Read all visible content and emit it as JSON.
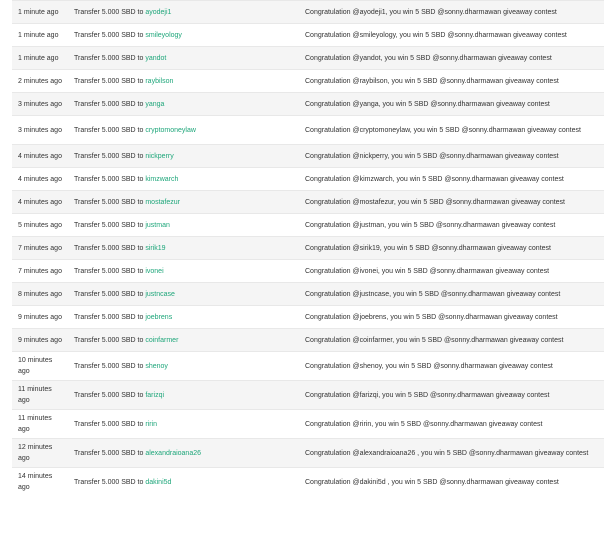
{
  "colors": {
    "link": "#1ea67a",
    "row_alt": "#f5f5f5",
    "border": "#e8e8e8",
    "text": "#333333"
  },
  "transactions": [
    {
      "time": "1 minute ago",
      "prefix": "Transfer 5.000 SBD to",
      "account": "ayodeji1",
      "memo": "Congratulation @ayodeji1, you win 5 SBD @sonny.dharmawan giveaway contest"
    },
    {
      "time": "1 minute ago",
      "prefix": "Transfer 5.000 SBD to",
      "account": "smileyology",
      "memo": "Congratulation @smileyology, you win 5 SBD @sonny.dharmawan giveaway contest"
    },
    {
      "time": "1 minute ago",
      "prefix": "Transfer 5.000 SBD to",
      "account": "yandot",
      "memo": "Congratulation @yandot, you win 5 SBD @sonny.dharmawan giveaway contest"
    },
    {
      "time": "2 minutes ago",
      "prefix": "Transfer 5.000 SBD to",
      "account": "raybilson",
      "memo": "Congratulation @raybilson, you win 5 SBD @sonny.dharmawan giveaway contest"
    },
    {
      "time": "3 minutes ago",
      "prefix": "Transfer 5.000 SBD to",
      "account": "yanga",
      "memo": "Congratulation @yanga, you win 5 SBD @sonny.dharmawan giveaway contest"
    },
    {
      "time": "3 minutes ago",
      "prefix": "Transfer 5.000 SBD to",
      "account": "cryptomoneylaw",
      "memo": "Congratulation @cryptomoneylaw, you win 5 SBD @sonny.dharmawan giveaway contest"
    },
    {
      "time": "4 minutes ago",
      "prefix": "Transfer 5.000 SBD to",
      "account": "nickperry",
      "memo": "Congratulation @nickperry, you win 5 SBD @sonny.dharmawan giveaway contest"
    },
    {
      "time": "4 minutes ago",
      "prefix": "Transfer 5.000 SBD to",
      "account": "kimzwarch",
      "memo": "Congratulation @kimzwarch, you win 5 SBD @sonny.dharmawan giveaway contest"
    },
    {
      "time": "4 minutes ago",
      "prefix": "Transfer 5.000 SBD to",
      "account": "mostafezur",
      "memo": "Congratulation @mostafezur, you win 5 SBD @sonny.dharmawan giveaway contest"
    },
    {
      "time": "5 minutes ago",
      "prefix": "Transfer 5.000 SBD to",
      "account": "justman",
      "memo": "Congratulation @justman, you win 5 SBD @sonny.dharmawan giveaway contest"
    },
    {
      "time": "7 minutes ago",
      "prefix": "Transfer 5.000 SBD to",
      "account": "sirik19",
      "memo": "Congratulation @sirik19, you win 5 SBD @sonny.dharmawan giveaway contest"
    },
    {
      "time": "7 minutes ago",
      "prefix": "Transfer 5.000 SBD to",
      "account": "ivonei",
      "memo": "Congratulation @ivonei, you win 5 SBD @sonny.dharmawan giveaway contest"
    },
    {
      "time": "8 minutes ago",
      "prefix": "Transfer 5.000 SBD to",
      "account": "justncase",
      "memo": "Congratulation @justncase, you win 5 SBD @sonny.dharmawan giveaway contest"
    },
    {
      "time": "9 minutes ago",
      "prefix": "Transfer 5.000 SBD to",
      "account": "joebrens",
      "memo": "Congratulation @joebrens, you win 5 SBD @sonny.dharmawan giveaway contest"
    },
    {
      "time": "9 minutes ago",
      "prefix": "Transfer 5.000 SBD to",
      "account": "coinfarmer",
      "memo": "Congratulation @coinfarmer, you win 5 SBD @sonny.dharmawan giveaway contest"
    },
    {
      "time": "10 minutes ago",
      "prefix": "Transfer 5.000 SBD to",
      "account": "shenoy",
      "memo": "Congratulation @shenoy, you win 5 SBD @sonny.dharmawan giveaway contest"
    },
    {
      "time": "11 minutes ago",
      "prefix": "Transfer 5.000 SBD to",
      "account": "farizqi",
      "memo": "Congratulation @farizqi, you win 5 SBD @sonny.dharmawan giveaway contest"
    },
    {
      "time": "11 minutes ago",
      "prefix": "Transfer 5.000 SBD to",
      "account": "ririn",
      "memo": "Congratulation @ririn, you win 5 SBD @sonny.dharmawan giveaway contest"
    },
    {
      "time": "12 minutes ago",
      "prefix": "Transfer 5.000 SBD to",
      "account": "alexandraioana26",
      "memo": "Congratulation @alexandraioana26 , you win 5 SBD @sonny.dharmawan giveaway contest"
    },
    {
      "time": "14 minutes ago",
      "prefix": "Transfer 5.000 SBD to",
      "account": "dakini5d",
      "memo": "Congratulation @dakini5d , you win 5 SBD @sonny.dharmawan giveaway contest"
    }
  ]
}
